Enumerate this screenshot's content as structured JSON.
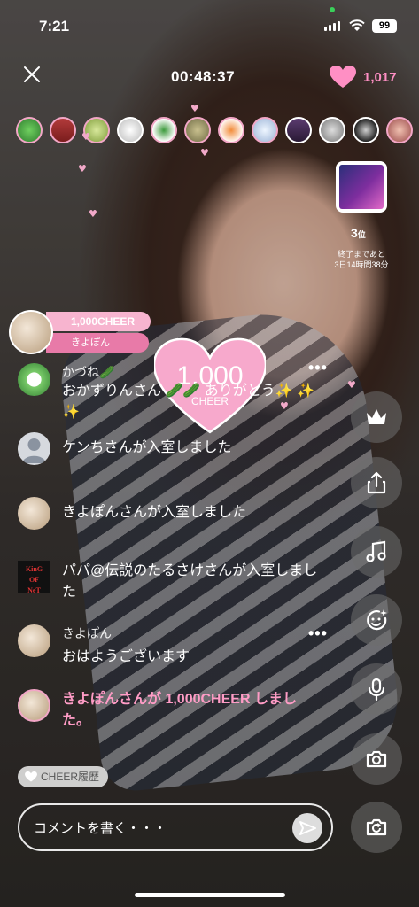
{
  "status": {
    "time": "7:21",
    "battery": "99"
  },
  "top": {
    "timer": "00:48:37",
    "likes": "1,017"
  },
  "viewers": [
    "avatar-1",
    "avatar-2",
    "avatar-3",
    "avatar-4",
    "avatar-5",
    "avatar-6",
    "avatar-7",
    "avatar-8",
    "avatar-9",
    "avatar-10",
    "avatar-11",
    "avatar-12"
  ],
  "ranking": {
    "position": "3",
    "suffix": "位",
    "remaining_label": "終了まであと",
    "remaining": "3日14時間38分"
  },
  "cheer_notice": {
    "amount": "1,000CHEER",
    "user": "きよぽん"
  },
  "big_heart": {
    "value": "1,000",
    "label": "CHEER"
  },
  "chat": [
    {
      "name": "かづね🥒",
      "message": "おかずりんさん 🥒🥒 ありがとう✨ ✨ ✨",
      "has_more": true
    },
    {
      "name": "",
      "message": "ケンちさんが入室しました",
      "has_more": false
    },
    {
      "name": "",
      "message": "きよぽんさんが入室しました",
      "has_more": false
    },
    {
      "name": "",
      "message": "パパ@伝説のたるさけさんが入室しました",
      "has_more": false
    },
    {
      "name": "きよぽん",
      "message": "おはようございます",
      "has_more": true
    },
    {
      "name": "",
      "message": "きよぽんさんが 1,000CHEER しました。",
      "has_more": false
    }
  ],
  "more_label": "•••",
  "cheer_history_label": "CHEER履歴",
  "comment": {
    "placeholder": "コメントを書く・・・",
    "value": ""
  },
  "colors": {
    "pink": "#f2a6c6",
    "heart": "#ff8fc4"
  }
}
